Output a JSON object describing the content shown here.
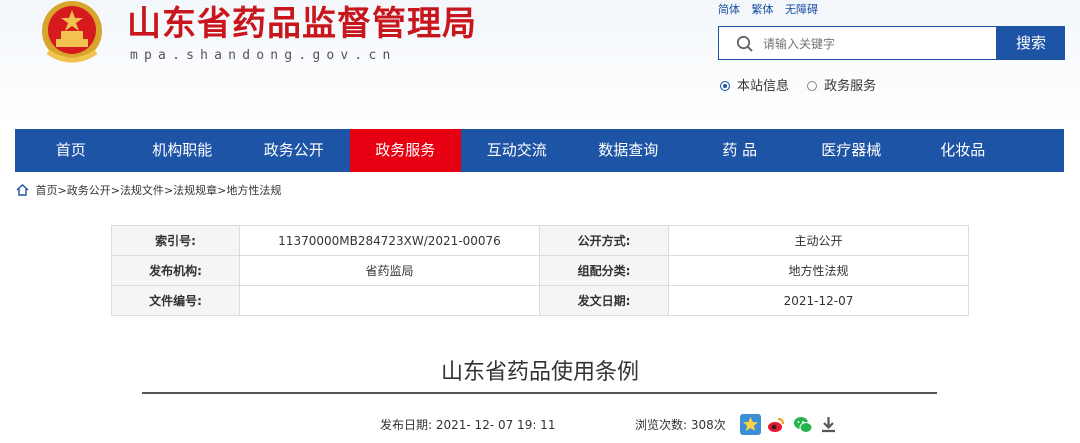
{
  "site": {
    "title": "山东省药品监督管理局",
    "domain": "mpa.shandong.gov.cn"
  },
  "language_links": [
    "简体",
    "繁体",
    "无障碍"
  ],
  "search": {
    "placeholder": "请输入关键字",
    "button_label": "搜索",
    "scope_options": [
      "本站信息",
      "政务服务"
    ],
    "selected_scope": "本站信息"
  },
  "nav": {
    "items": [
      "首页",
      "机构职能",
      "政务公开",
      "政务服务",
      "互动交流",
      "数据查询",
      "药 品",
      "医疗器械",
      "化妆品"
    ],
    "active": "政务服务"
  },
  "breadcrumb": [
    "首页",
    "政务公开",
    "法规文件",
    "法规规章",
    "地方性法规"
  ],
  "meta": {
    "rows": [
      {
        "label1": "索引号:",
        "value1": "11370000MB284723XW/2021-00076",
        "label2": "公开方式:",
        "value2": "主动公开"
      },
      {
        "label1": "发布机构:",
        "value1": "省药监局",
        "label2": "组配分类:",
        "value2": "地方性法规"
      },
      {
        "label1": "文件编号:",
        "value1": "",
        "label2": "发文日期:",
        "value2": "2021-12-07"
      }
    ]
  },
  "article": {
    "title": "山东省药品使用条例",
    "publish_label": "发布日期:",
    "publish_date": "2021- 12- 07 19: 11",
    "views_label": "浏览次数:",
    "views": "308次"
  },
  "colors": {
    "primary_blue": "#1e54a6",
    "active_red": "#e60012",
    "title_red": "#c8161d"
  },
  "icons": [
    "search-icon",
    "home-icon",
    "favorite-icon",
    "weibo-icon",
    "wechat-icon",
    "download-icon"
  ]
}
